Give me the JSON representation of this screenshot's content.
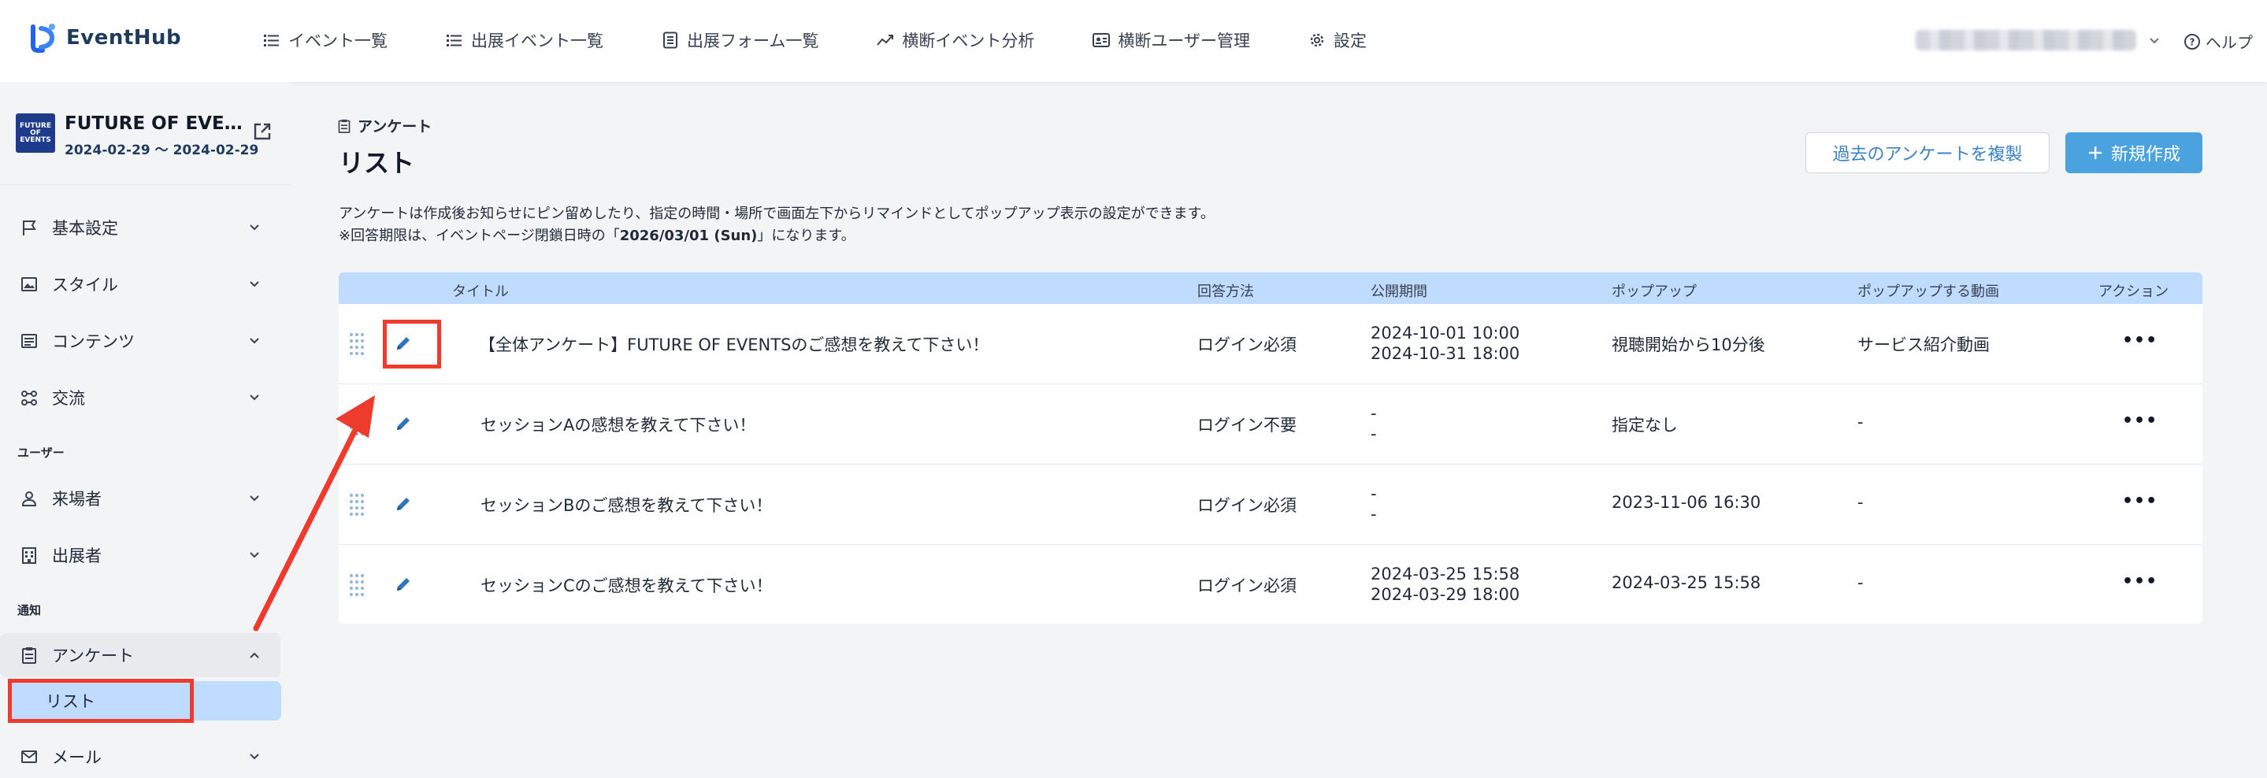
{
  "app": {
    "name": "EventHub"
  },
  "topnav": {
    "items": [
      {
        "label": "イベント一覧",
        "icon": "list-icon"
      },
      {
        "label": "出展イベント一覧",
        "icon": "list-icon"
      },
      {
        "label": "出展フォーム一覧",
        "icon": "form-icon"
      },
      {
        "label": "横断イベント分析",
        "icon": "chart-icon"
      },
      {
        "label": "横断ユーザー管理",
        "icon": "id-card-icon"
      },
      {
        "label": "設定",
        "icon": "gear-icon"
      }
    ],
    "help": "ヘルプ"
  },
  "event": {
    "title": "FUTURE OF EVENTS",
    "dates": "2024-02-29 〜 2024-02-29",
    "thumb_text": "FUTURE OF EVENTS"
  },
  "sidebar": {
    "items": [
      {
        "label": "基本設定",
        "icon": "flag-icon"
      },
      {
        "label": "スタイル",
        "icon": "image-icon"
      },
      {
        "label": "コンテンツ",
        "icon": "document-icon"
      },
      {
        "label": "交流",
        "icon": "network-icon"
      }
    ],
    "section_user": "ユーザー",
    "user_items": [
      {
        "label": "来場者",
        "icon": "person-icon"
      },
      {
        "label": "出展者",
        "icon": "building-icon"
      }
    ],
    "section_notice": "通知",
    "survey": {
      "label": "アンケート",
      "icon": "clipboard-icon"
    },
    "survey_sub": "リスト",
    "mail": {
      "label": "メール",
      "icon": "mail-icon"
    }
  },
  "main": {
    "breadcrumb": "アンケート",
    "title": "リスト",
    "btn_duplicate": "過去のアンケートを複製",
    "btn_new": "新規作成",
    "desc_line1": "アンケートは作成後お知らせにピン留めしたり、指定の時間・場所で画面左下からリマインドとしてポップアップ表示の設定ができます。",
    "desc_line2_pre": "※回答期限は、イベントページ閉鎖日時の「",
    "desc_line2_bold": "2026/03/01 (Sun)",
    "desc_line2_post": "」になります。"
  },
  "table": {
    "headers": {
      "title": "タイトル",
      "method": "回答方法",
      "period": "公開期間",
      "popup": "ポップアップ",
      "popup_video": "ポップアップする動画",
      "action": "アクション"
    },
    "rows": [
      {
        "title": "【全体アンケート】FUTURE OF EVENTSのご感想を教えて下さい！",
        "method": "ログイン必須",
        "period_start": "2024-10-01 10:00",
        "period_end": "2024-10-31 18:00",
        "popup": "視聴開始から10分後",
        "video": "サービス紹介動画",
        "more": "•••"
      },
      {
        "title": "セッションAの感想を教えて下さい！",
        "method": "ログイン不要",
        "period_start": "-",
        "period_end": "-",
        "popup": "指定なし",
        "video": "-",
        "more": "•••"
      },
      {
        "title": "セッションBのご感想を教えて下さい！",
        "method": "ログイン必須",
        "period_start": "-",
        "period_end": "-",
        "popup": "2023-11-06 16:30",
        "video": "-",
        "more": "•••"
      },
      {
        "title": "セッションCのご感想を教えて下さい！",
        "method": "ログイン必須",
        "period_start": "2024-03-25 15:58",
        "period_end": "2024-03-29 18:00",
        "popup": "2024-03-25 15:58",
        "video": "-",
        "more": "•••"
      }
    ]
  },
  "colors": {
    "accent": "#4aa3df",
    "highlight": "#ef3b2d",
    "header_bg": "#bfdbfe"
  }
}
